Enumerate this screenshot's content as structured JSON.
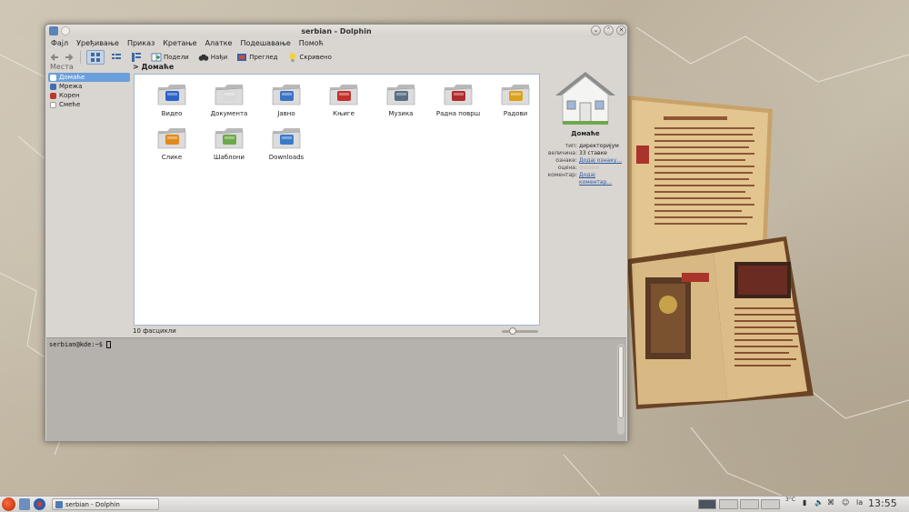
{
  "window": {
    "title": "serbian - Dolphin",
    "minimize_glyph": "⌄",
    "maximize_glyph": "⌃",
    "close_glyph": "✕"
  },
  "menu": [
    "Фајл",
    "Уређивање",
    "Приказ",
    "Кретање",
    "Алатке",
    "Подешавање",
    "Помоћ"
  ],
  "toolbar": {
    "split_label": "Подели",
    "find_label": "Нађи",
    "preview_label": "Преглед",
    "hidden_label": "Скривено"
  },
  "places": {
    "header": "Места",
    "items": [
      {
        "label": "Домаће",
        "selected": true,
        "icon": "home-icon",
        "color": "#ffffff"
      },
      {
        "label": "Мрежа",
        "selected": false,
        "icon": "network-icon",
        "color": "#3f6fb0"
      },
      {
        "label": "Корен",
        "selected": false,
        "icon": "root-icon",
        "color": "#b83a2f"
      },
      {
        "label": "Смеће",
        "selected": false,
        "icon": "trash-icon",
        "color": "#9a9a9a"
      }
    ]
  },
  "breadcrumb": {
    "arrow": ">",
    "label": "Домаће"
  },
  "files": [
    {
      "label": "Видео",
      "icon": "video-folder-icon",
      "accent": "#2d63c8"
    },
    {
      "label": "Документа",
      "icon": "documents-folder-icon",
      "accent": "#d8d8d8"
    },
    {
      "label": "Јавно",
      "icon": "public-folder-icon",
      "accent": "#3b74c4"
    },
    {
      "label": "Књиге",
      "icon": "pdf-folder-icon",
      "accent": "#c4302b"
    },
    {
      "label": "Музика",
      "icon": "music-folder-icon",
      "accent": "#5a6f82"
    },
    {
      "label": "Радна површ",
      "icon": "desktop-folder-icon",
      "accent": "#b02c2c"
    },
    {
      "label": "Радови",
      "icon": "projects-folder-icon",
      "accent": "#d9a21b"
    },
    {
      "label": "Слике",
      "icon": "pictures-folder-icon",
      "accent": "#e08a1e"
    },
    {
      "label": "Шаблони",
      "icon": "templates-folder-icon",
      "accent": "#6ea84a"
    },
    {
      "label": "Downloads",
      "icon": "downloads-folder-icon",
      "accent": "#3a7bc8"
    }
  ],
  "info": {
    "name": "Домаће",
    "rows": [
      {
        "key": "тип:",
        "value": "директоријум",
        "link": false
      },
      {
        "key": "величина:",
        "value": "33 ставке",
        "link": false
      },
      {
        "key": "ознаке:",
        "value": "Додај ознаку...",
        "link": true
      },
      {
        "key": "оцена:",
        "value": "☆☆☆☆☆",
        "link": false
      },
      {
        "key": "коментар:",
        "value": "Додај коментар...",
        "link": true
      }
    ]
  },
  "status": {
    "folders": "10 фасцикли"
  },
  "terminal": {
    "prompt": "serbian@kde:~$"
  },
  "taskbar": {
    "task_label": "serbian - Dolphin",
    "temperature": "3°C",
    "keyboard": "la",
    "clock": "13:55"
  }
}
